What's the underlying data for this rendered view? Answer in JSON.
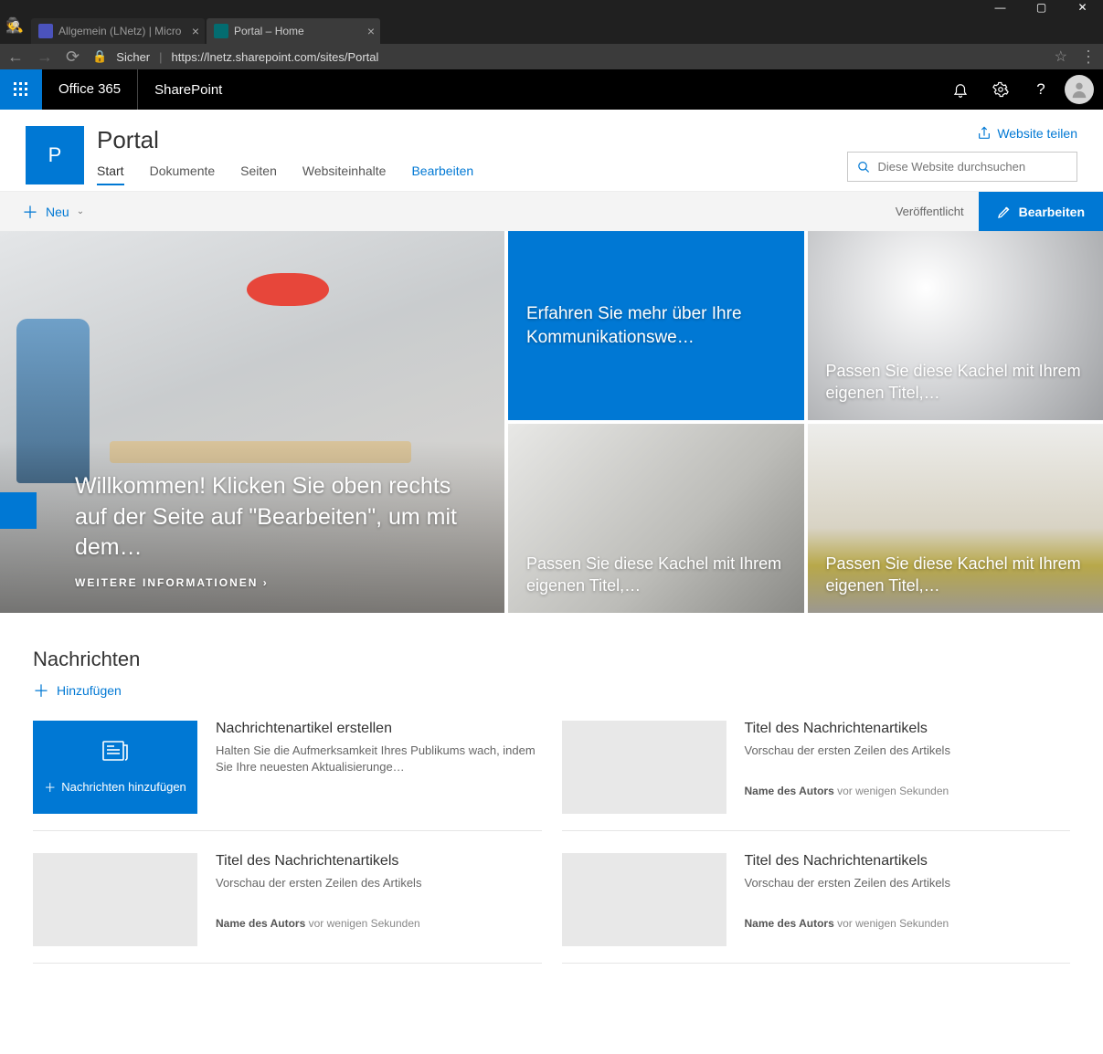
{
  "browser": {
    "tabs": [
      {
        "label": "Allgemein (LNetz) | Micro",
        "active": false
      },
      {
        "label": "Portal – Home",
        "active": true
      }
    ],
    "secure_label": "Sicher",
    "url": "https://lnetz.sharepoint.com/sites/Portal"
  },
  "suite": {
    "brand": "Office 365",
    "app": "SharePoint"
  },
  "site": {
    "logo_letter": "P",
    "title": "Portal",
    "share_label": "Website teilen",
    "search_placeholder": "Diese Website durchsuchen",
    "nav": {
      "start": "Start",
      "dokumente": "Dokumente",
      "seiten": "Seiten",
      "websiteinhalte": "Websiteinhalte",
      "bearbeiten": "Bearbeiten"
    }
  },
  "cmdbar": {
    "new": "Neu",
    "published": "Veröffentlicht",
    "edit": "Bearbeiten"
  },
  "hero": {
    "main_title": "Willkommen! Klicken Sie oben rechts auf der Seite auf \"Bearbeiten\", um mit dem…",
    "main_link": "WEITERE INFORMATIONEN",
    "tiles": {
      "t1": "Erfahren Sie mehr über Ihre Kommunikationswe…",
      "t2": "Passen Sie diese Kachel mit Ihrem eigenen Titel,…",
      "t3": "Passen Sie diese Kachel mit Ihrem eigenen Titel,…",
      "t4": "Passen Sie diese Kachel mit Ihrem eigenen Titel,…"
    }
  },
  "news": {
    "heading": "Nachrichten",
    "add": "Hinzufügen",
    "add_card": "Nachrichten hinzufügen",
    "cards": [
      {
        "title": "Nachrichtenartikel erstellen",
        "desc": "Halten Sie die Aufmerksamkeit Ihres Publikums wach, indem Sie Ihre neuesten Aktualisierunge…",
        "author": "",
        "time": ""
      },
      {
        "title": "Titel des Nachrichtenartikels",
        "desc": "Vorschau der ersten Zeilen des Artikels",
        "author": "Name des Autors",
        "time": "vor wenigen Sekunden"
      },
      {
        "title": "Titel des Nachrichtenartikels",
        "desc": "Vorschau der ersten Zeilen des Artikels",
        "author": "Name des Autors",
        "time": "vor wenigen Sekunden"
      },
      {
        "title": "Titel des Nachrichtenartikels",
        "desc": "Vorschau der ersten Zeilen des Artikels",
        "author": "Name des Autors",
        "time": "vor wenigen Sekunden"
      }
    ]
  }
}
